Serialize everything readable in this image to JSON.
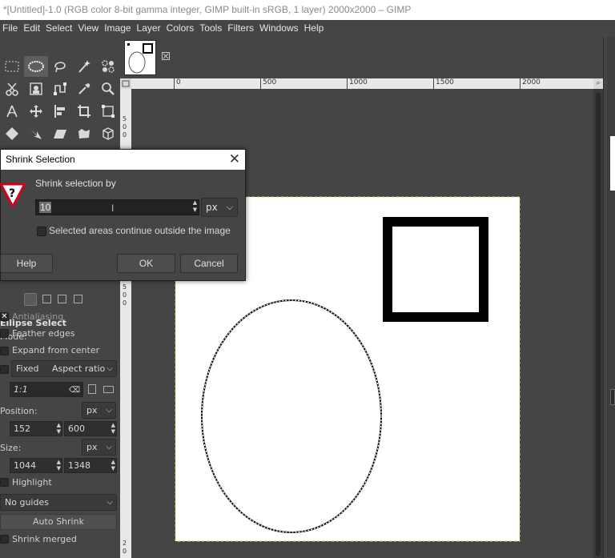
{
  "window": {
    "title": "*[Untitled]-1.0 (RGB color 8-bit gamma integer, GIMP built-in sRGB, 1 layer) 2000x2000 – GIMP"
  },
  "menu": [
    "File",
    "Edit",
    "Select",
    "View",
    "Image",
    "Layer",
    "Colors",
    "Tools",
    "Filters",
    "Windows",
    "Help"
  ],
  "ruler": {
    "h_ticks": [
      "0",
      "500",
      "1000",
      "1500",
      "2000"
    ]
  },
  "tool_options": {
    "title": "Ellipse Select",
    "mode_label": "Mode:",
    "antialiasing": "Antialiasing",
    "feather_edges": "Feather edges",
    "expand_from_center": "Expand from center",
    "fixed": "Fixed",
    "fixed_mode": "Aspect ratio",
    "ratio_value": "1:1",
    "position_label": "Position:",
    "position_unit": "px",
    "position_x": "152",
    "position_y": "600",
    "size_label": "Size:",
    "size_unit": "px",
    "size_w": "1044",
    "size_h": "1348",
    "highlight": "Highlight",
    "guides": "No guides",
    "auto_shrink": "Auto Shrink",
    "shrink_merged": "Shrink merged"
  },
  "dialog": {
    "title": "Shrink Selection",
    "heading": "Shrink selection by",
    "value": "10",
    "unit": "px",
    "checkbox_label": "Selected areas continue outside the image",
    "help": "Help",
    "ok": "OK",
    "cancel": "Cancel"
  },
  "colors": {
    "accent_warning": "#d0021b",
    "canvas_bg": "#ffffff",
    "ui_bg": "#454545"
  }
}
